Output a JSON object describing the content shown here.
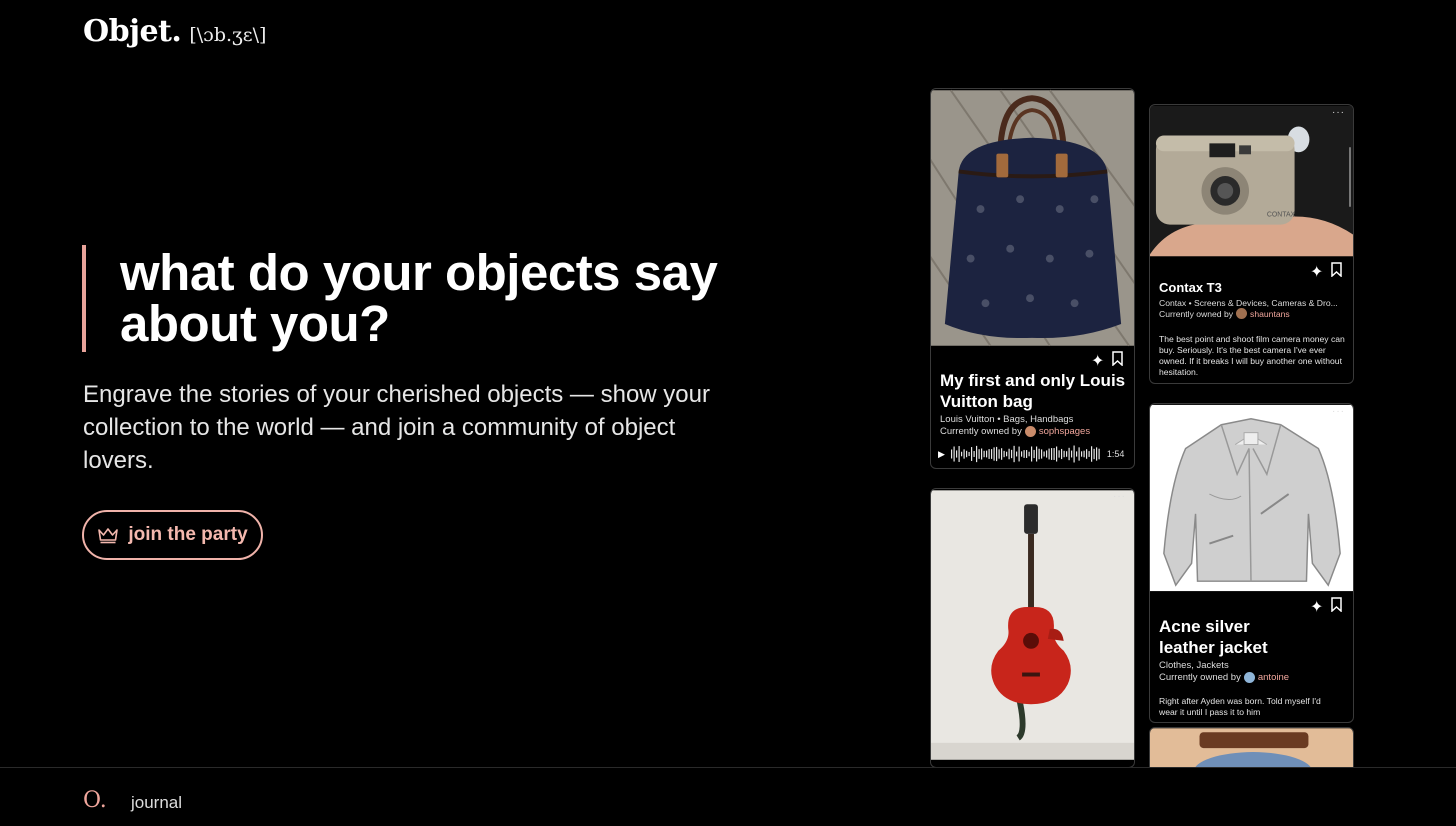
{
  "header": {
    "logo_word": "Objet.",
    "logo_phonetic": "[\\ɔb.ʒɛ\\]"
  },
  "hero": {
    "headline": "what do your objects say about you?",
    "subtitle": "Engrave the stories of your cherished objects — show your collection to the world — and join a community of object lovers.",
    "cta_label": "join the party",
    "cta_icon": "crown-icon",
    "accent": "#e8a39a"
  },
  "cards": {
    "louis": {
      "title": "My first and only Louis Vuitton bag",
      "meta": "Louis Vuitton • Bags, Handbags",
      "owned_prefix": "Currently owned by",
      "owner": "sophspages",
      "duration": "1:54"
    },
    "contax": {
      "title": "Contax T3",
      "meta": "Contax • Screens & Devices, Cameras & Dro...",
      "owned_prefix": "Currently owned by",
      "owner": "shauntans",
      "desc": "The best point and shoot film camera money can buy. Seriously. It's the best camera I've ever owned. If it breaks I will buy another one without hesitation.",
      "camera_brand": "CONTAX"
    },
    "acne": {
      "title": "Acne silver leather jacket",
      "meta": "Clothes, Jackets",
      "owned_prefix": "Currently owned by",
      "owner": "antoine",
      "desc": "Right after Ayden was born. Told myself I'd wear it until I pass it to him"
    },
    "more_dots": "···"
  },
  "footer": {
    "mark": "O.",
    "journal_label": "journal"
  }
}
